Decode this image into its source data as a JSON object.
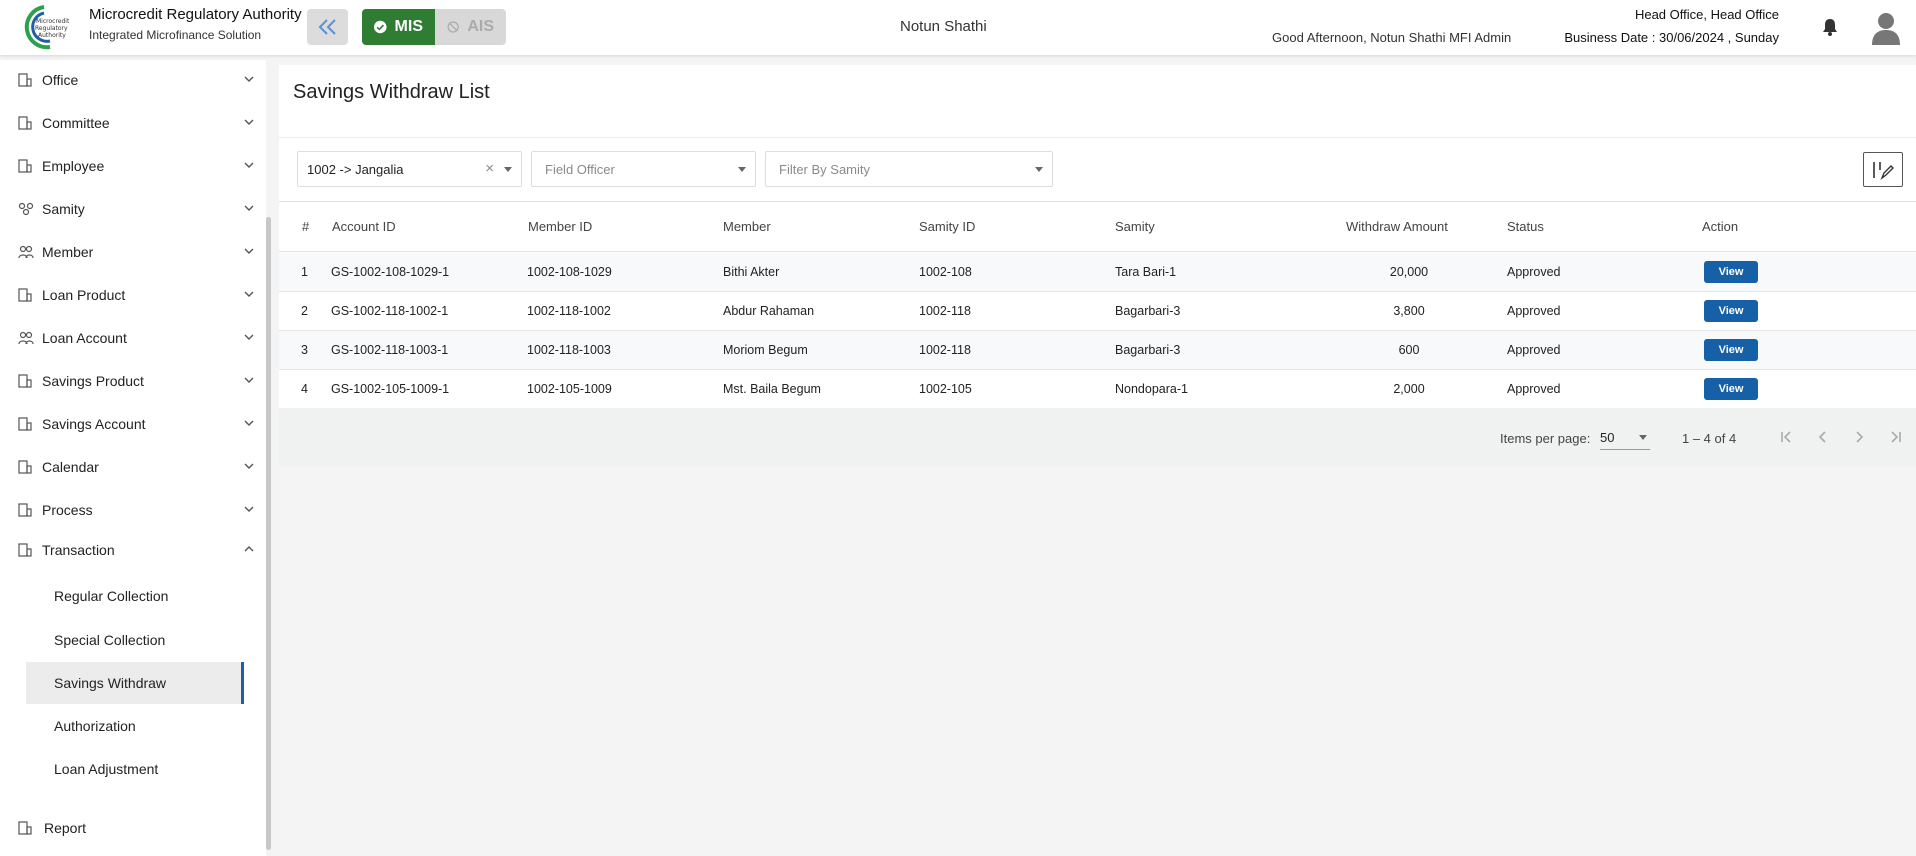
{
  "header": {
    "brand_title": "Microcredit Regulatory Authority",
    "brand_subtitle": "Integrated Microfinance Solution",
    "logo_text": [
      "Microcredit",
      "Regulatory",
      "Authority"
    ],
    "mode_mis": "MIS",
    "mode_ais": "AIS",
    "org_name": "Notun Shathi",
    "greeting": "Good Afternoon, Notun Shathi MFI Admin",
    "office": "Head Office, Head Office",
    "business_date": "Business Date : 30/06/2024 , Sunday"
  },
  "sidebar": {
    "items": [
      {
        "label": "Office"
      },
      {
        "label": "Committee"
      },
      {
        "label": "Employee"
      },
      {
        "label": "Samity"
      },
      {
        "label": "Member"
      },
      {
        "label": "Loan Product"
      },
      {
        "label": "Loan Account"
      },
      {
        "label": "Savings Product"
      },
      {
        "label": "Savings Account"
      },
      {
        "label": "Calendar"
      },
      {
        "label": "Process"
      },
      {
        "label": "Transaction"
      }
    ],
    "transaction_sub": [
      {
        "label": "Regular Collection"
      },
      {
        "label": "Special Collection"
      },
      {
        "label": "Savings Withdraw"
      },
      {
        "label": "Authorization"
      },
      {
        "label": "Loan Adjustment"
      }
    ],
    "report": "Report"
  },
  "main": {
    "title": "Savings Withdraw List",
    "filters": {
      "branch": "1002 -> Jangalia",
      "clear": "×",
      "field_officer_placeholder": "Field Officer",
      "samity_placeholder": "Filter By Samity"
    },
    "columns": [
      "#",
      "Account ID",
      "Member ID",
      "Member",
      "Samity ID",
      "Samity",
      "Withdraw Amount",
      "Status",
      "Action"
    ],
    "rows": [
      {
        "no": "1",
        "account_id": "GS-1002-108-1029-1",
        "member_id": "1002-108-1029",
        "member": "Bithi Akter",
        "samity_id": "1002-108",
        "samity": "Tara Bari-1",
        "amount": "20,000",
        "status": "Approved",
        "action": "View"
      },
      {
        "no": "2",
        "account_id": "GS-1002-118-1002-1",
        "member_id": "1002-118-1002",
        "member": "Abdur Rahaman",
        "samity_id": "1002-118",
        "samity": "Bagarbari-3",
        "amount": "3,800",
        "status": "Approved",
        "action": "View"
      },
      {
        "no": "3",
        "account_id": "GS-1002-118-1003-1",
        "member_id": "1002-118-1003",
        "member": "Moriom Begum",
        "samity_id": "1002-118",
        "samity": "Bagarbari-3",
        "amount": "600",
        "status": "Approved",
        "action": "View"
      },
      {
        "no": "4",
        "account_id": "GS-1002-105-1009-1",
        "member_id": "1002-105-1009",
        "member": "Mst. Baila Begum",
        "samity_id": "1002-105",
        "samity": "Nondopara-1",
        "amount": "2,000",
        "status": "Approved",
        "action": "View"
      }
    ],
    "paginator": {
      "items_per_page_label": "Items per page:",
      "items_per_page": "50",
      "range": "1 – 4 of 4"
    }
  },
  "colors": {
    "accent": "#1660a8",
    "mis_green": "#2e7d32",
    "logo_green": "#2aa14a"
  }
}
